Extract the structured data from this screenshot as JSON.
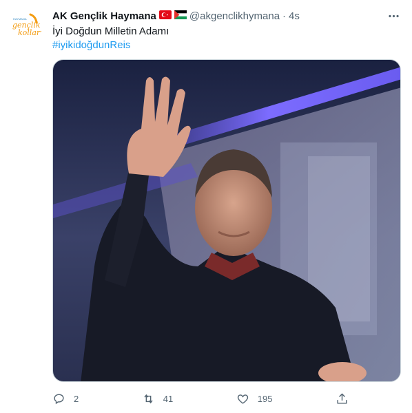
{
  "tweet": {
    "display_name": "AK Gençlik Haymana",
    "handle": "@akgenclikhymana",
    "separator": "·",
    "time": "4s",
    "flags": [
      "turkey-flag",
      "palestine-flag"
    ],
    "text_line1": "İyi Doğdun Milletin Adamı",
    "hashtag": "#iyikidoğdunReis",
    "avatar_logo": {
      "small_text": "HAYMANA",
      "line1": "gençlik",
      "line2": "kolları"
    },
    "media_description_icon": "photo"
  },
  "actions": {
    "reply_count": "2",
    "retweet_count": "41",
    "like_count": "195",
    "icons": [
      "reply-icon",
      "retweet-icon",
      "like-icon",
      "share-icon"
    ]
  },
  "colors": {
    "accent": "#1d9bf0",
    "muted": "#536471",
    "logo_orange": "#f39c12",
    "logo_blue": "#2e86c1"
  }
}
